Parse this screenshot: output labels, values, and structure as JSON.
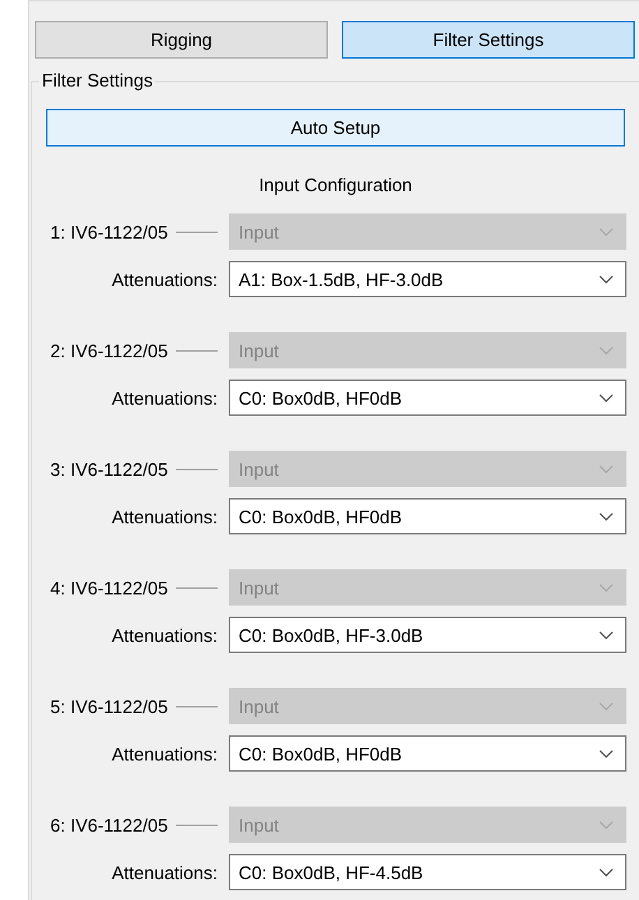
{
  "tabs": [
    {
      "label": "Rigging",
      "selected": false
    },
    {
      "label": "Filter Settings",
      "selected": true
    }
  ],
  "group": {
    "title": "Filter Settings",
    "auto_setup_button": "Auto Setup",
    "section_title": "Input Configuration",
    "inputs": [
      {
        "label": "1: IV6-1122/05",
        "input": {
          "value": "Input",
          "disabled": true
        },
        "attenuation_label": "Attenuations:",
        "attenuation": {
          "value": "A1: Box-1.5dB, HF-3.0dB",
          "disabled": false
        }
      },
      {
        "label": "2: IV6-1122/05",
        "input": {
          "value": "Input",
          "disabled": true
        },
        "attenuation_label": "Attenuations:",
        "attenuation": {
          "value": "C0: Box0dB, HF0dB",
          "disabled": false
        }
      },
      {
        "label": "3: IV6-1122/05",
        "input": {
          "value": "Input",
          "disabled": true
        },
        "attenuation_label": "Attenuations:",
        "attenuation": {
          "value": "C0: Box0dB, HF0dB",
          "disabled": false
        }
      },
      {
        "label": "4: IV6-1122/05",
        "input": {
          "value": "Input",
          "disabled": true
        },
        "attenuation_label": "Attenuations:",
        "attenuation": {
          "value": "C0: Box0dB, HF-3.0dB",
          "disabled": false
        }
      },
      {
        "label": "5: IV6-1122/05",
        "input": {
          "value": "Input",
          "disabled": true
        },
        "attenuation_label": "Attenuations:",
        "attenuation": {
          "value": "C0: Box0dB, HF0dB",
          "disabled": false
        }
      },
      {
        "label": "6: IV6-1122/05",
        "input": {
          "value": "Input",
          "disabled": true
        },
        "attenuation_label": "Attenuations:",
        "attenuation": {
          "value": "C0: Box0dB, HF-4.5dB",
          "disabled": false
        }
      }
    ]
  }
}
